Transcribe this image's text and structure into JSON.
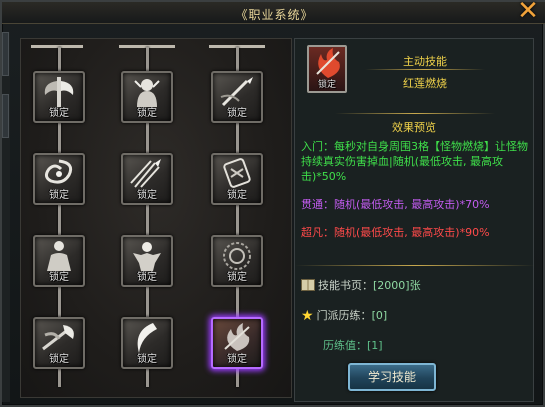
{
  "window": {
    "title": "《职业系统》",
    "close_glyph": "✕"
  },
  "tree": {
    "lock_label": "锁定",
    "skills": [
      {
        "icon": "battle-axe-icon",
        "label": "锁定"
      },
      {
        "icon": "demon-icon",
        "label": "锁定"
      },
      {
        "icon": "spear-icon",
        "label": "锁定"
      },
      {
        "icon": "whirlwind-icon",
        "label": "锁定"
      },
      {
        "icon": "arrow-rain-icon",
        "label": "锁定"
      },
      {
        "icon": "shield-seal-icon",
        "label": "锁定"
      },
      {
        "icon": "meditation-icon",
        "label": "锁定"
      },
      {
        "icon": "berserker-icon",
        "label": "锁定"
      },
      {
        "icon": "rune-circle-icon",
        "label": "锁定"
      },
      {
        "icon": "war-axe-icon",
        "label": "锁定"
      },
      {
        "icon": "crescent-blade-icon",
        "label": "锁定"
      },
      {
        "icon": "flame-strike-icon",
        "label": "锁定"
      }
    ]
  },
  "detail": {
    "icon": "red-lotus-icon",
    "lock_label": "锁定",
    "category": "主动技能",
    "name": "红莲燃烧",
    "preview_heading": "效果预览",
    "effect_base": "入门：每秒对自身周围3格【怪物燃烧】让怪物持续真实伤害掉血|随机(最低攻击, 最高攻击)*50%",
    "effect_rare": "贯通：随机(最低攻击, 最高攻击)*70%",
    "effect_epic": "超凡：随机(最低攻击, 最高攻击)*90%",
    "book_label": "技能书页：",
    "book_value": "[2000]张",
    "school_label": "门派历练：",
    "school_value": "[0]",
    "mastery_label": "历练值：",
    "mastery_value": "[1]"
  },
  "learn_button": "学习技能",
  "colors": {
    "title": "#e9d79a",
    "gold": "#f0d24a",
    "base_effect": "#3fe04a",
    "rare_effect": "#c35cf0",
    "epic_effect": "#ff4a4a",
    "active_glow": "#9b3cff"
  }
}
